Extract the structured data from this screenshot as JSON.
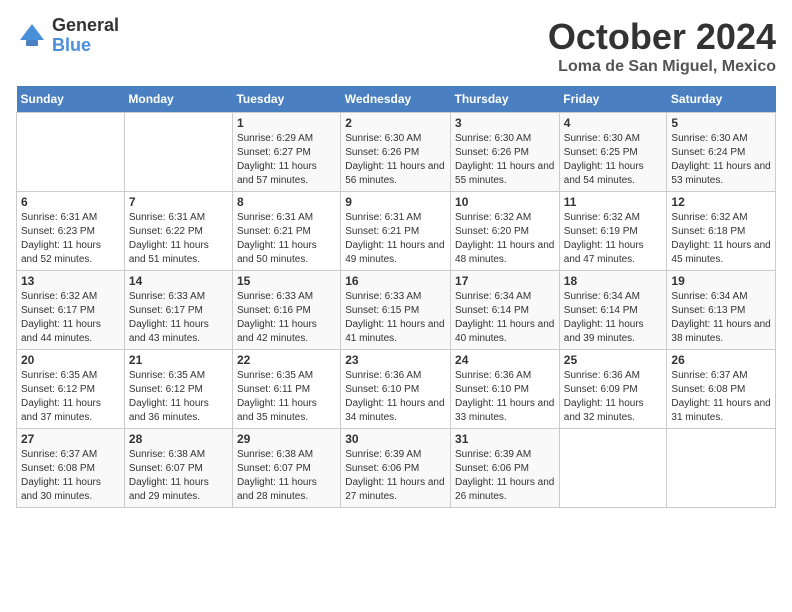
{
  "logo": {
    "general": "General",
    "blue": "Blue"
  },
  "title": "October 2024",
  "location": "Loma de San Miguel, Mexico",
  "days_header": [
    "Sunday",
    "Monday",
    "Tuesday",
    "Wednesday",
    "Thursday",
    "Friday",
    "Saturday"
  ],
  "weeks": [
    [
      {
        "day": "",
        "info": ""
      },
      {
        "day": "",
        "info": ""
      },
      {
        "day": "1",
        "info": "Sunrise: 6:29 AM\nSunset: 6:27 PM\nDaylight: 11 hours and 57 minutes."
      },
      {
        "day": "2",
        "info": "Sunrise: 6:30 AM\nSunset: 6:26 PM\nDaylight: 11 hours and 56 minutes."
      },
      {
        "day": "3",
        "info": "Sunrise: 6:30 AM\nSunset: 6:26 PM\nDaylight: 11 hours and 55 minutes."
      },
      {
        "day": "4",
        "info": "Sunrise: 6:30 AM\nSunset: 6:25 PM\nDaylight: 11 hours and 54 minutes."
      },
      {
        "day": "5",
        "info": "Sunrise: 6:30 AM\nSunset: 6:24 PM\nDaylight: 11 hours and 53 minutes."
      }
    ],
    [
      {
        "day": "6",
        "info": "Sunrise: 6:31 AM\nSunset: 6:23 PM\nDaylight: 11 hours and 52 minutes."
      },
      {
        "day": "7",
        "info": "Sunrise: 6:31 AM\nSunset: 6:22 PM\nDaylight: 11 hours and 51 minutes."
      },
      {
        "day": "8",
        "info": "Sunrise: 6:31 AM\nSunset: 6:21 PM\nDaylight: 11 hours and 50 minutes."
      },
      {
        "day": "9",
        "info": "Sunrise: 6:31 AM\nSunset: 6:21 PM\nDaylight: 11 hours and 49 minutes."
      },
      {
        "day": "10",
        "info": "Sunrise: 6:32 AM\nSunset: 6:20 PM\nDaylight: 11 hours and 48 minutes."
      },
      {
        "day": "11",
        "info": "Sunrise: 6:32 AM\nSunset: 6:19 PM\nDaylight: 11 hours and 47 minutes."
      },
      {
        "day": "12",
        "info": "Sunrise: 6:32 AM\nSunset: 6:18 PM\nDaylight: 11 hours and 45 minutes."
      }
    ],
    [
      {
        "day": "13",
        "info": "Sunrise: 6:32 AM\nSunset: 6:17 PM\nDaylight: 11 hours and 44 minutes."
      },
      {
        "day": "14",
        "info": "Sunrise: 6:33 AM\nSunset: 6:17 PM\nDaylight: 11 hours and 43 minutes."
      },
      {
        "day": "15",
        "info": "Sunrise: 6:33 AM\nSunset: 6:16 PM\nDaylight: 11 hours and 42 minutes."
      },
      {
        "day": "16",
        "info": "Sunrise: 6:33 AM\nSunset: 6:15 PM\nDaylight: 11 hours and 41 minutes."
      },
      {
        "day": "17",
        "info": "Sunrise: 6:34 AM\nSunset: 6:14 PM\nDaylight: 11 hours and 40 minutes."
      },
      {
        "day": "18",
        "info": "Sunrise: 6:34 AM\nSunset: 6:14 PM\nDaylight: 11 hours and 39 minutes."
      },
      {
        "day": "19",
        "info": "Sunrise: 6:34 AM\nSunset: 6:13 PM\nDaylight: 11 hours and 38 minutes."
      }
    ],
    [
      {
        "day": "20",
        "info": "Sunrise: 6:35 AM\nSunset: 6:12 PM\nDaylight: 11 hours and 37 minutes."
      },
      {
        "day": "21",
        "info": "Sunrise: 6:35 AM\nSunset: 6:12 PM\nDaylight: 11 hours and 36 minutes."
      },
      {
        "day": "22",
        "info": "Sunrise: 6:35 AM\nSunset: 6:11 PM\nDaylight: 11 hours and 35 minutes."
      },
      {
        "day": "23",
        "info": "Sunrise: 6:36 AM\nSunset: 6:10 PM\nDaylight: 11 hours and 34 minutes."
      },
      {
        "day": "24",
        "info": "Sunrise: 6:36 AM\nSunset: 6:10 PM\nDaylight: 11 hours and 33 minutes."
      },
      {
        "day": "25",
        "info": "Sunrise: 6:36 AM\nSunset: 6:09 PM\nDaylight: 11 hours and 32 minutes."
      },
      {
        "day": "26",
        "info": "Sunrise: 6:37 AM\nSunset: 6:08 PM\nDaylight: 11 hours and 31 minutes."
      }
    ],
    [
      {
        "day": "27",
        "info": "Sunrise: 6:37 AM\nSunset: 6:08 PM\nDaylight: 11 hours and 30 minutes."
      },
      {
        "day": "28",
        "info": "Sunrise: 6:38 AM\nSunset: 6:07 PM\nDaylight: 11 hours and 29 minutes."
      },
      {
        "day": "29",
        "info": "Sunrise: 6:38 AM\nSunset: 6:07 PM\nDaylight: 11 hours and 28 minutes."
      },
      {
        "day": "30",
        "info": "Sunrise: 6:39 AM\nSunset: 6:06 PM\nDaylight: 11 hours and 27 minutes."
      },
      {
        "day": "31",
        "info": "Sunrise: 6:39 AM\nSunset: 6:06 PM\nDaylight: 11 hours and 26 minutes."
      },
      {
        "day": "",
        "info": ""
      },
      {
        "day": "",
        "info": ""
      }
    ]
  ]
}
